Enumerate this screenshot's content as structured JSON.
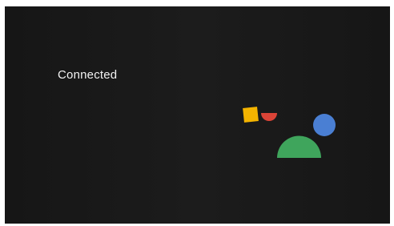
{
  "screen": {
    "status_text": "Connected"
  },
  "illustration": {
    "shapes": [
      {
        "name": "yellow-square",
        "color": "#f4b400"
      },
      {
        "name": "red-half-circle",
        "color": "#db4437"
      },
      {
        "name": "blue-circle",
        "color": "#4a7fd3"
      },
      {
        "name": "green-semicircle",
        "color": "#3fa55c"
      }
    ]
  },
  "colors": {
    "background": "#1a1a1a",
    "text": "#f2f2f2"
  }
}
